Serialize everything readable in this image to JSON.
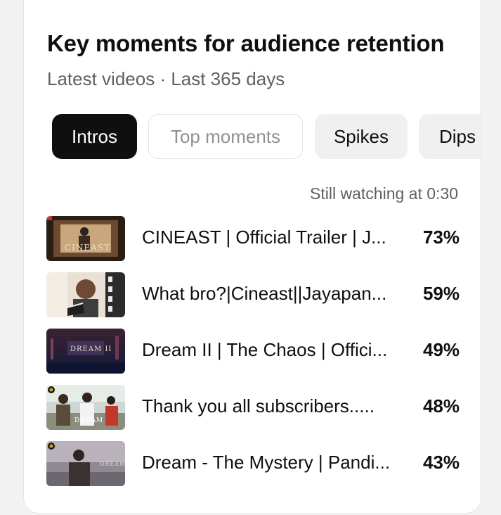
{
  "card": {
    "title": "Key moments for audience retention",
    "subtitle": "Latest videos · Last 365 days"
  },
  "tabs": [
    {
      "label": "Intros",
      "state": "selected"
    },
    {
      "label": "Top moments",
      "state": "outlined"
    },
    {
      "label": "Spikes",
      "state": "default"
    },
    {
      "label": "Dips",
      "state": "default"
    }
  ],
  "list": {
    "header": "Still watching at 0:30",
    "videos": [
      {
        "title": "CINEAST | Official Trailer | J...",
        "percent": "73%",
        "thumb_text": "CINEAST"
      },
      {
        "title": "What bro?|Cineast||Jayapan...",
        "percent": "59%",
        "thumb_text": ""
      },
      {
        "title": "Dream II | The Chaos | Offici...",
        "percent": "49%",
        "thumb_text": "DREAM II"
      },
      {
        "title": "Thank you all subscribers.....",
        "percent": "48%",
        "thumb_text": "DREAM"
      },
      {
        "title": "Dream - The Mystery | Pandi...",
        "percent": "43%",
        "thumb_text": "DREAM"
      }
    ]
  },
  "colors": {
    "chip_selected_bg": "#0f0f0f",
    "chip_default_bg": "#f0f0f0",
    "text_primary": "#0f0f0f",
    "text_secondary": "#606060"
  }
}
